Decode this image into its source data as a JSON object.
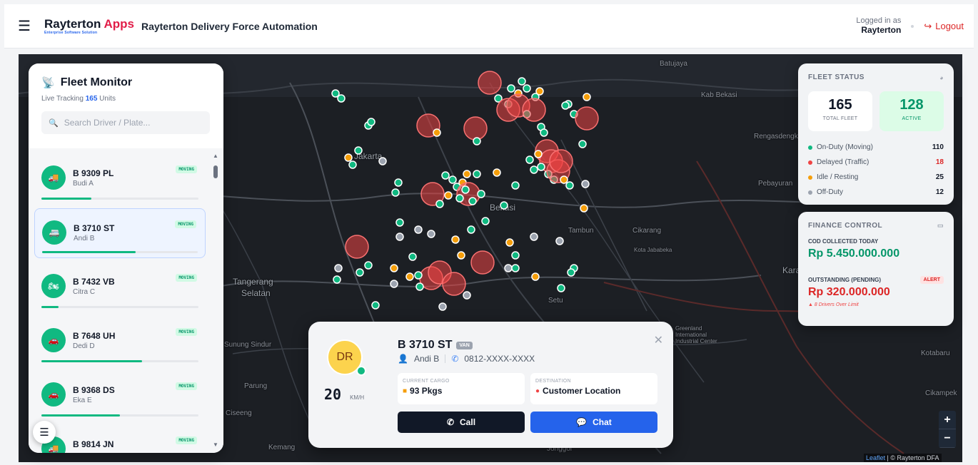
{
  "header": {
    "brand_main": "Rayterton",
    "brand_accent": "Apps",
    "brand_sub": "Enterprise Software Solution",
    "app_title": "Rayterton Delivery Force Automation",
    "logged_in_label": "Logged in as",
    "username": "Rayterton",
    "logout_label": "Logout"
  },
  "map": {
    "labels": [
      "Batujaya",
      "Kab Bekasi",
      "Rengasdengklo",
      "Jakarta",
      "Bekasi",
      "Tambun",
      "Cikarang",
      "Kota Jababeka",
      "Karawa",
      "Tangerang",
      "Selatan",
      "Setu",
      "Pebayuran",
      "Sunung Sindur",
      "Parung",
      "Ciseeng",
      "Kemang",
      "Jonggol",
      "Cikampek",
      "Kotabaru",
      "Greenland International Industrial Center"
    ],
    "attribution_leaflet": "Leaflet",
    "attribution_rest": "| © Rayterton DFA",
    "zoom_in": "+",
    "zoom_out": "−"
  },
  "fleet_monitor": {
    "title": "Fleet Monitor",
    "subtitle_prefix": "Live Tracking",
    "unit_count": "165",
    "subtitle_suffix": "Units",
    "search_placeholder": "Search Driver / Plate...",
    "vehicles": [
      {
        "plate": "B 9309 PL",
        "driver": "Budi A",
        "status": "MOVING",
        "progress": 0.32
      },
      {
        "plate": "B 3710 ST",
        "driver": "Andi B",
        "status": "MOVING",
        "progress": 0.6
      },
      {
        "plate": "B 7432 VB",
        "driver": "Citra C",
        "status": "MOVING",
        "progress": 0.11
      },
      {
        "plate": "B 7648 UH",
        "driver": "Dedi D",
        "status": "MOVING",
        "progress": 0.64
      },
      {
        "plate": "B 9368 DS",
        "driver": "Eka E",
        "status": "MOVING",
        "progress": 0.5
      },
      {
        "plate": "B 9814 JN",
        "driver": "",
        "status": "MOVING",
        "progress": 0
      }
    ]
  },
  "fleet_status": {
    "title": "FLEET STATUS",
    "total_value": "165",
    "total_label": "TOTAL FLEET",
    "active_value": "128",
    "active_label": "ACTIVE",
    "rows": [
      {
        "label": "On-Duty (Moving)",
        "value": "110",
        "color": "#10b981"
      },
      {
        "label": "Delayed (Traffic)",
        "value": "18",
        "color": "#ef4444"
      },
      {
        "label": "Idle / Resting",
        "value": "25",
        "color": "#f59e0b"
      },
      {
        "label": "Off-Duty",
        "value": "12",
        "color": "#9ca3af"
      }
    ]
  },
  "finance": {
    "title": "FINANCE CONTROL",
    "cod_label": "COD COLLECTED TODAY",
    "cod_value": "Rp 5.450.000.000",
    "outstanding_label": "OUTSTANDING (PENDING)",
    "alert_label": "ALERT",
    "outstanding_value": "Rp 320.000.000",
    "warning": "8 Drivers Over Limit"
  },
  "driver_card": {
    "initials": "DR",
    "speed": "20",
    "speed_unit": "KM/H",
    "plate": "B 3710 ST",
    "vehicle_type": "VAN",
    "driver_name": "Andi B",
    "phone": "0812-XXXX-XXXX",
    "cargo_label": "CURRENT CARGO",
    "cargo_value": "93 Pkgs",
    "destination_label": "DESTINATION",
    "destination_value": "Customer Location",
    "call_label": "Call",
    "chat_label": "Chat"
  },
  "colors": {
    "accent": "#2563eb",
    "moving": "#10b981",
    "delayed": "#ef4444",
    "idle": "#f59e0b",
    "off": "#9ca3af"
  }
}
